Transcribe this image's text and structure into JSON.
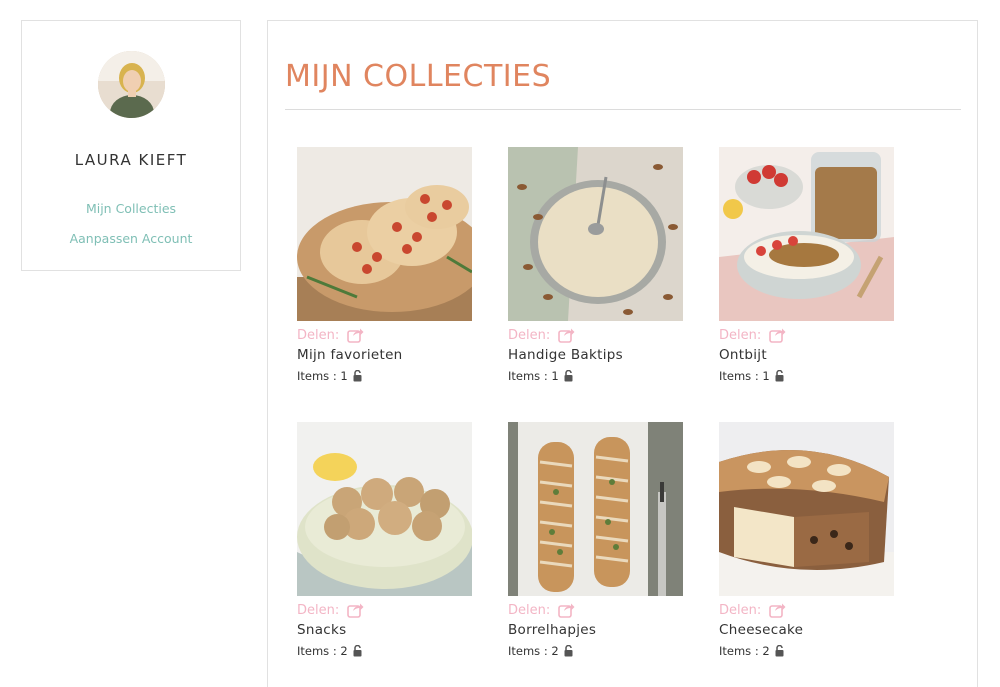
{
  "profile": {
    "name": "LAURA KIEFT",
    "links": [
      "Mijn Collecties",
      "Aanpassen Account"
    ]
  },
  "main": {
    "title": "MIJN COLLECTIES"
  },
  "collections": [
    {
      "title": "Mijn favorieten",
      "share_label": "Delen:",
      "items_text": "Items : 1",
      "image": "focaccia-photo"
    },
    {
      "title": "Handige Baktips",
      "share_label": "Delen:",
      "items_text": "Items : 1",
      "image": "almond-flour-photo"
    },
    {
      "title": "Ontbijt",
      "share_label": "Delen:",
      "items_text": "Items : 1",
      "image": "granola-bowl-photo"
    },
    {
      "title": "Snacks",
      "share_label": "Delen:",
      "items_text": "Items : 2",
      "image": "energy-balls-photo"
    },
    {
      "title": "Borrelhapjes",
      "share_label": "Delen:",
      "items_text": "Items : 2",
      "image": "garlic-bread-photo"
    },
    {
      "title": "Cheesecake",
      "share_label": "Delen:",
      "items_text": "Items : 2",
      "image": "cheesecake-photo"
    }
  ],
  "colors": {
    "accent_title": "#e0855f",
    "link": "#7fbfb5",
    "share": "#f3b5c5",
    "border": "#e1e1e1"
  },
  "icons": {
    "share": "share-arrow-icon",
    "lock": "unlocked-padlock-icon"
  }
}
